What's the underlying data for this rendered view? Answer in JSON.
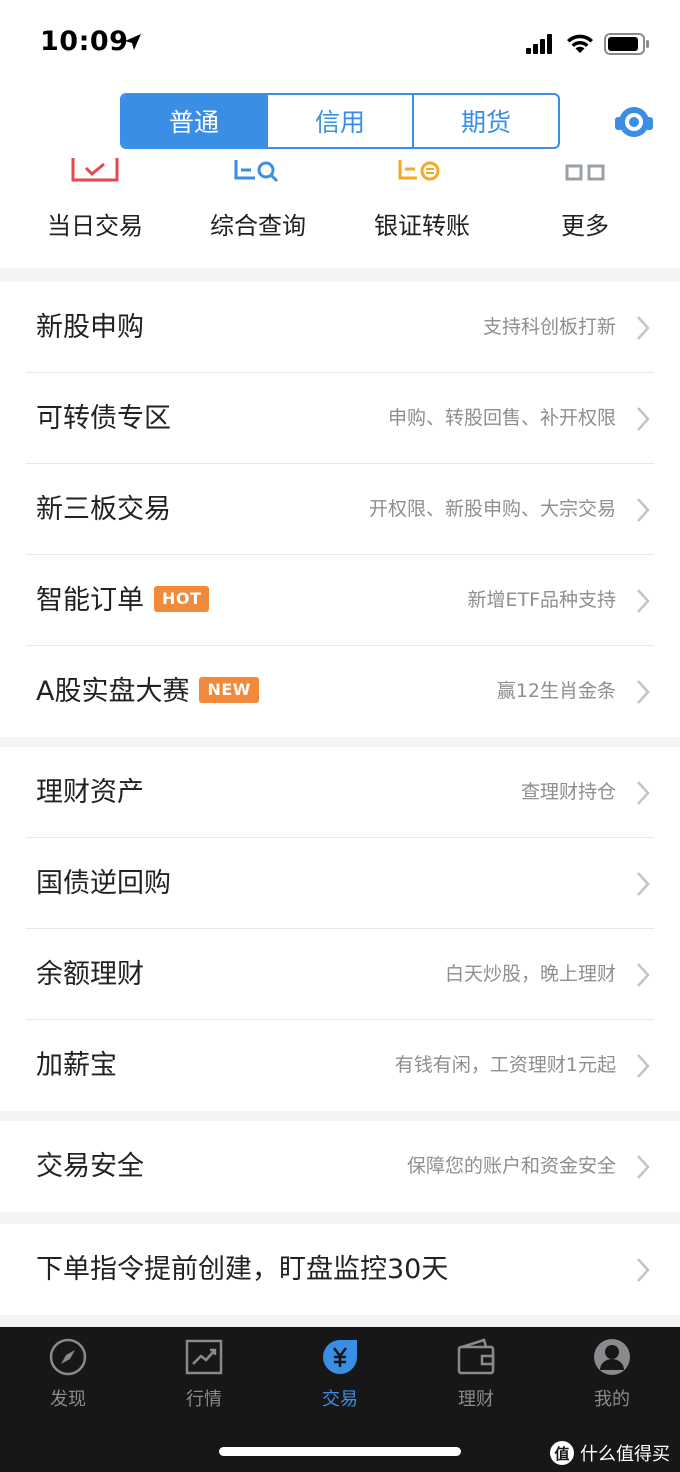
{
  "status_bar": {
    "time": "10:09"
  },
  "header": {
    "segments": [
      "普通",
      "信用",
      "期货"
    ],
    "active_segment": "普通"
  },
  "quick_actions": [
    {
      "label": "当日交易",
      "icon": "daily-trade-icon",
      "color": "#e8474b"
    },
    {
      "label": "综合查询",
      "icon": "query-icon",
      "color": "#3a8ee6"
    },
    {
      "label": "银证转账",
      "icon": "transfer-icon",
      "color": "#f5a623"
    },
    {
      "label": "更多",
      "icon": "more-grid-icon",
      "color": "#9aa0a8"
    }
  ],
  "section1": [
    {
      "title": "新股申购",
      "sub": "支持科创板打新"
    },
    {
      "title": "可转债专区",
      "sub": "申购、转股回售、补开权限"
    },
    {
      "title": "新三板交易",
      "sub": "开权限、新股申购、大宗交易"
    },
    {
      "title": "智能订单",
      "badge": "HOT",
      "sub": "新增ETF品种支持"
    },
    {
      "title": "A股实盘大赛",
      "badge": "NEW",
      "sub": "赢12生肖金条"
    }
  ],
  "section2": [
    {
      "title": "理财资产",
      "sub": "查理财持仓"
    },
    {
      "title": "国债逆回购",
      "sub": ""
    },
    {
      "title": "余额理财",
      "sub": "白天炒股，晚上理财"
    },
    {
      "title": "加薪宝",
      "sub": "有钱有闲，工资理财1元起"
    }
  ],
  "section3": [
    {
      "title": "交易安全",
      "sub": "保障您的账户和资金安全"
    }
  ],
  "section4": [
    {
      "title": "下单指令提前创建，盯盘监控30天",
      "sub": ""
    }
  ],
  "tabbar": {
    "items": [
      {
        "label": "发现",
        "icon": "compass-icon"
      },
      {
        "label": "行情",
        "icon": "chart-icon"
      },
      {
        "label": "交易",
        "icon": "yen-coin-icon"
      },
      {
        "label": "理财",
        "icon": "wallet-icon"
      },
      {
        "label": "我的",
        "icon": "profile-icon"
      }
    ],
    "active": "交易"
  },
  "watermark": {
    "logo": "值",
    "text": "什么值得买"
  },
  "colors": {
    "accent": "#3a8ee6",
    "badge": "#f08a3a",
    "tabbar_bg": "#171717"
  }
}
